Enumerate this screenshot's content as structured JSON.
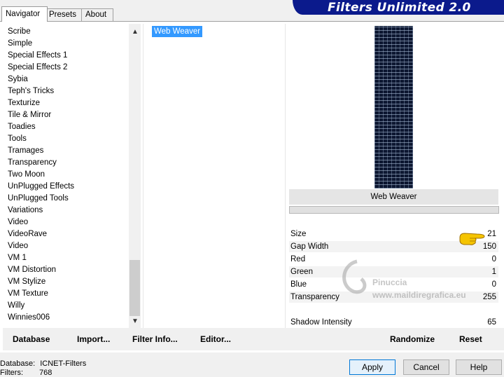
{
  "tabs": [
    {
      "label": "Navigator"
    },
    {
      "label": "Presets"
    },
    {
      "label": "About"
    }
  ],
  "banner": {
    "title": "Filters Unlimited 2.0"
  },
  "categories": [
    "Scribe",
    "Simple",
    "Special Effects 1",
    "Special Effects 2",
    "Sybia",
    "Teph's Tricks",
    "Texturize",
    "Tile & Mirror",
    "Toadies",
    "Tools",
    "Tramages",
    "Transparency",
    "Two Moon",
    "UnPlugged Effects",
    "UnPlugged Tools",
    "Variations",
    "Video",
    "VideoRave",
    "Video",
    "VM 1",
    "VM Distortion",
    "VM Stylize",
    "VM Texture",
    "Willy",
    "Winnies006"
  ],
  "filters": {
    "selected": "Web Weaver"
  },
  "preview": {
    "filter_name": "Web Weaver"
  },
  "params": [
    {
      "label": "Size",
      "value": "21"
    },
    {
      "label": "Gap Width",
      "value": "150"
    },
    {
      "label": "Red",
      "value": "0"
    },
    {
      "label": "Green",
      "value": "1"
    },
    {
      "label": "Blue",
      "value": "0"
    },
    {
      "label": "Transparency",
      "value": "255"
    },
    {
      "label": "Shadow Intensity",
      "value": "65"
    }
  ],
  "watermark": {
    "line1": "Pinuccia",
    "line2": "www.maildiregrafica.eu"
  },
  "toolbar": {
    "database": "Database",
    "import": "Import...",
    "filter_info": "Filter Info...",
    "editor": "Editor...",
    "randomize": "Randomize",
    "reset": "Reset"
  },
  "status": {
    "database_label": "Database:",
    "database_value": "ICNET-Filters",
    "filters_label": "Filters:",
    "filters_value": "768"
  },
  "buttons": {
    "apply": "Apply",
    "cancel": "Cancel",
    "help": "Help"
  },
  "colors": {
    "banner": "#0b1a8c",
    "selection": "#3399ff",
    "accent_border": "#0078d7"
  }
}
